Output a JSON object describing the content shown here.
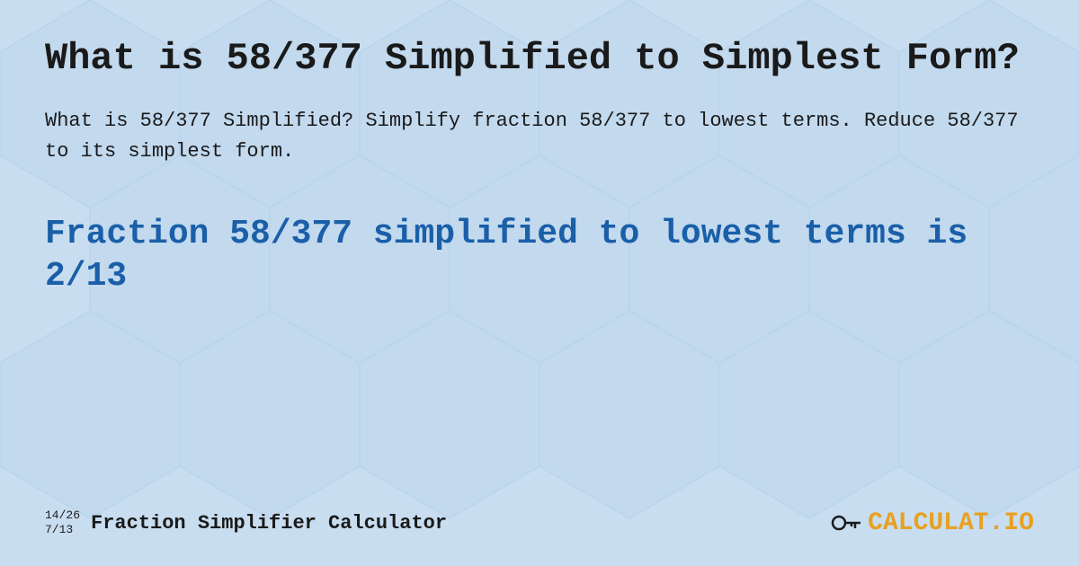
{
  "page": {
    "background_color": "#c8ddf0",
    "main_title": "What is 58/377 Simplified to Simplest Form?",
    "description": "What is 58/377 Simplified? Simplify fraction 58/377 to lowest terms. Reduce 58/377 to its simplest form.",
    "result_text": "Fraction 58/377 simplified to lowest terms is 2/13",
    "footer": {
      "fraction_top": "14/26",
      "fraction_bottom": "7/13",
      "site_label": "Fraction Simplifier Calculator",
      "logo_text_main": "CALCULAT",
      "logo_text_accent": ".IO"
    }
  }
}
